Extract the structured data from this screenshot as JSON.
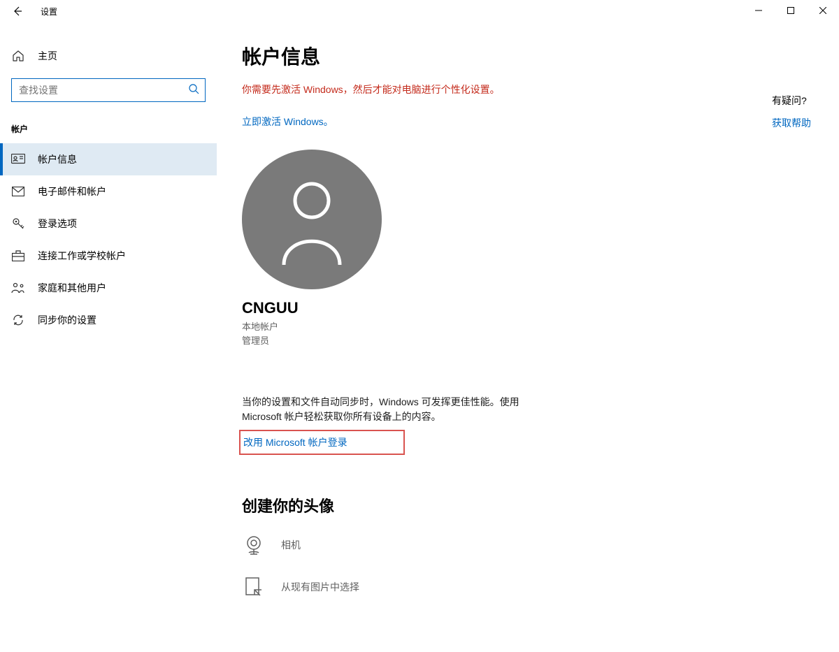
{
  "titlebar": {
    "title": "设置"
  },
  "sidebar": {
    "home_label": "主页",
    "search_placeholder": "查找设置",
    "section_heading": "帐户",
    "items": [
      {
        "label": "帐户信息",
        "icon": "account-info-icon",
        "active": true
      },
      {
        "label": "电子邮件和帐户",
        "icon": "email-icon",
        "active": false
      },
      {
        "label": "登录选项",
        "icon": "key-icon",
        "active": false
      },
      {
        "label": "连接工作或学校帐户",
        "icon": "briefcase-icon",
        "active": false
      },
      {
        "label": "家庭和其他用户",
        "icon": "family-icon",
        "active": false
      },
      {
        "label": "同步你的设置",
        "icon": "sync-icon",
        "active": false
      }
    ]
  },
  "main": {
    "page_title": "帐户信息",
    "activation_warning": "你需要先激活 Windows，然后才能对电脑进行个性化设置。",
    "activate_link": "立即激活 Windows。",
    "username": "CNGUU",
    "account_type": "本地帐户",
    "account_role": "管理员",
    "sync_description": "当你的设置和文件自动同步时，Windows 可发挥更佳性能。使用 Microsoft 帐户轻松获取你所有设备上的内容。",
    "ms_login_link": "改用 Microsoft 帐户登录",
    "avatar_section_title": "创建你的头像",
    "camera_label": "相机",
    "browse_label": "从现有图片中选择"
  },
  "help": {
    "title": "有疑问?",
    "link": "获取帮助"
  }
}
